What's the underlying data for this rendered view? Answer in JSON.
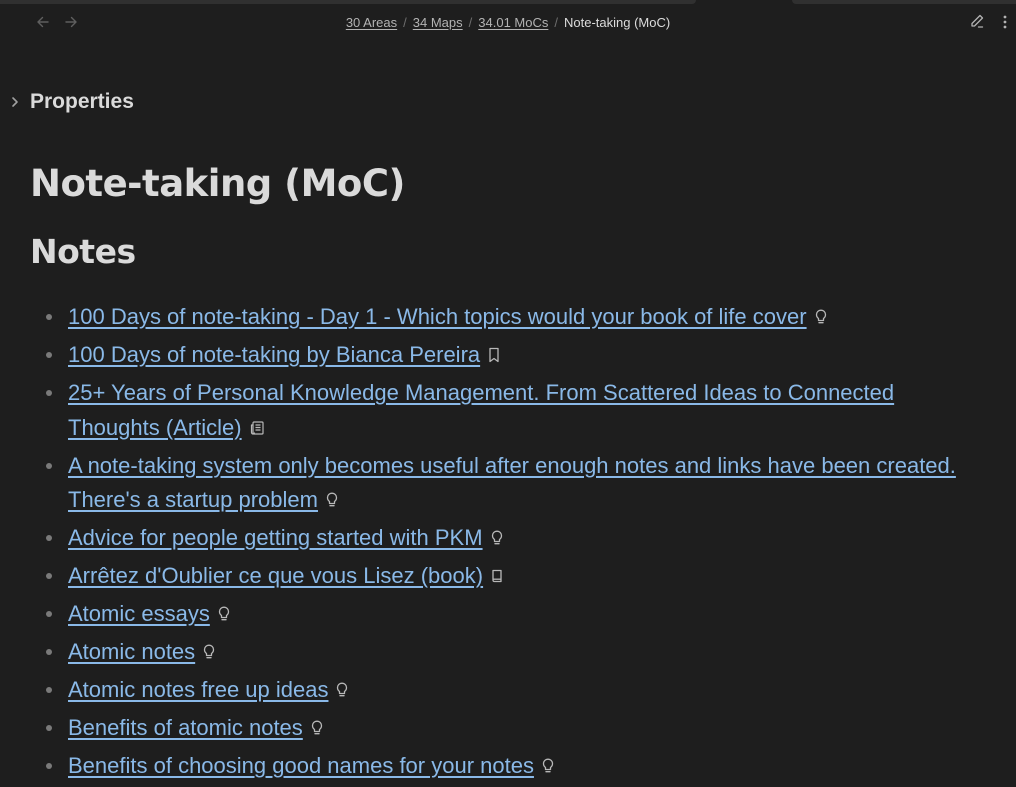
{
  "breadcrumb": {
    "items": [
      "30 Areas",
      "34 Maps",
      "34.01 MoCs"
    ],
    "separator": "/",
    "current": "Note-taking (MoC)"
  },
  "properties": {
    "label": "Properties"
  },
  "note": {
    "title": "Note-taking (MoC)",
    "section_heading": "Notes",
    "links": [
      {
        "text": "100 Days of note-taking - Day 1 - Which topics would your book of life cover",
        "icon": "lightbulb-icon"
      },
      {
        "text": "100 Days of note-taking by Bianca Pereira",
        "icon": "bookmark-icon"
      },
      {
        "text": "25+ Years of Personal Knowledge Management. From Scattered Ideas to Connected Thoughts (Article)",
        "icon": "newspaper-icon"
      },
      {
        "text": "A note-taking system only becomes useful after enough notes and links have been created. There's a startup problem",
        "icon": "lightbulb-icon"
      },
      {
        "text": "Advice for people getting started with PKM",
        "icon": "lightbulb-icon"
      },
      {
        "text": "Arrêtez d'Oublier ce que vous Lisez (book)",
        "icon": "book-icon"
      },
      {
        "text": "Atomic essays",
        "icon": "lightbulb-icon"
      },
      {
        "text": "Atomic notes",
        "icon": "lightbulb-icon"
      },
      {
        "text": "Atomic notes free up ideas",
        "icon": "lightbulb-icon"
      },
      {
        "text": "Benefits of atomic notes",
        "icon": "lightbulb-icon"
      },
      {
        "text": "Benefits of choosing good names for your notes",
        "icon": "lightbulb-icon"
      }
    ]
  },
  "colors": {
    "background": "#1e1e1e",
    "link": "#8ab9e8",
    "text": "#dadada",
    "muted": "#b3b3b3"
  }
}
